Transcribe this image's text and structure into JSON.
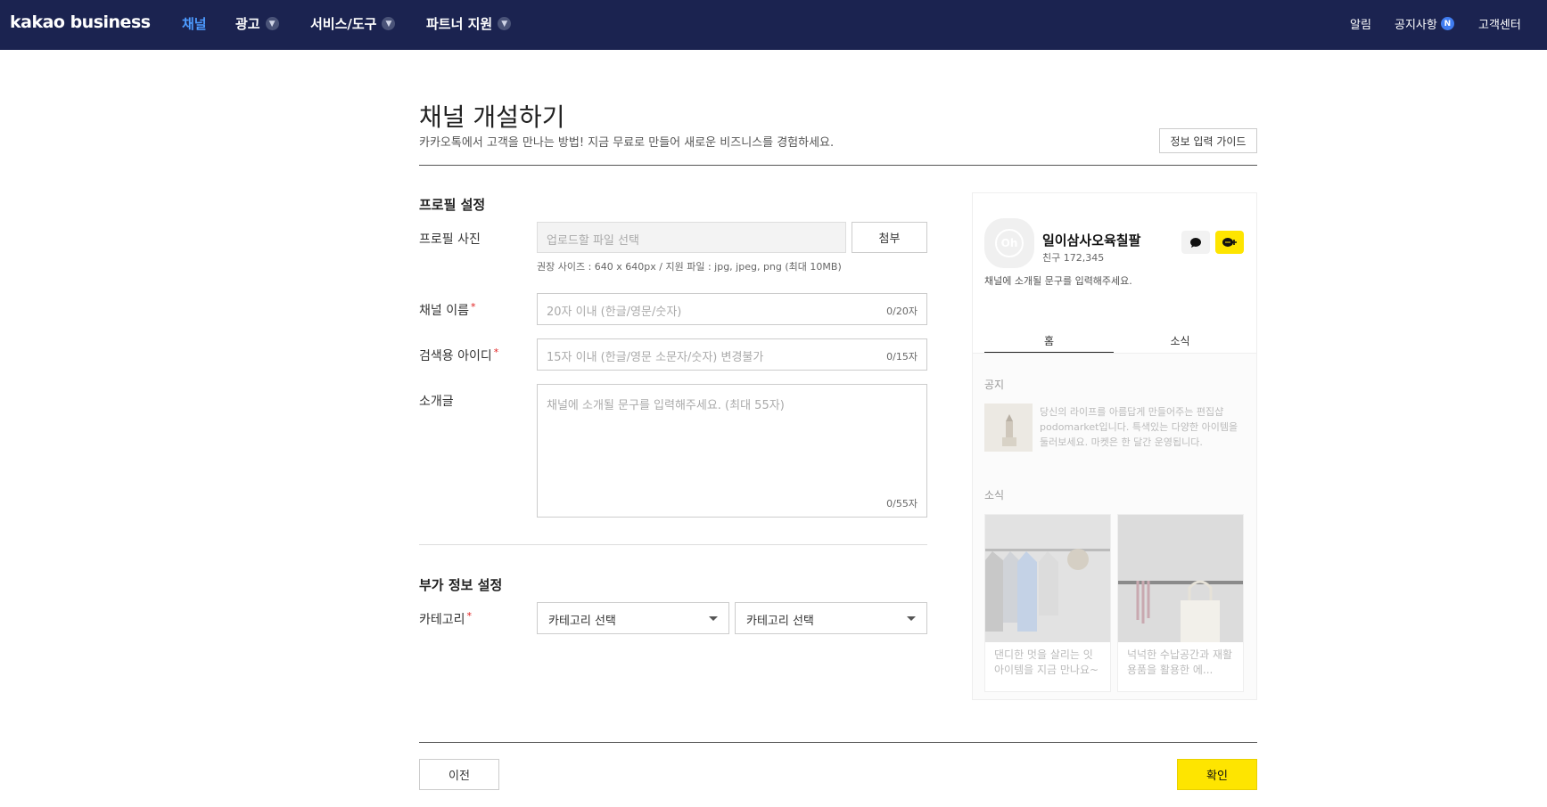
{
  "nav": {
    "logo": "kakao business",
    "items": [
      {
        "label": "채널",
        "active": true,
        "dropdown": false
      },
      {
        "label": "광고",
        "active": false,
        "dropdown": true
      },
      {
        "label": "서비스/도구",
        "active": false,
        "dropdown": true
      },
      {
        "label": "파트너 지원",
        "active": false,
        "dropdown": true
      }
    ],
    "right": {
      "alarm": "알림",
      "notice": "공지사항",
      "notice_badge": "N",
      "support": "고객센터"
    }
  },
  "header": {
    "title": "채널 개설하기",
    "subtitle": "카카오톡에서 고객을 만나는 방법! 지금 무료로 만들어 새로운 비즈니스를 경험하세요.",
    "guide_button": "정보 입력 가이드"
  },
  "profile": {
    "section_title": "프로필 설정",
    "photo_label": "프로필 사진",
    "photo_placeholder": "업로드할 파일 선택",
    "attach_button": "첨부",
    "photo_hint": "권장 사이즈 : 640 x 640px / 지원 파일 : jpg, jpeg, png (최대 10MB)",
    "name_label": "채널 이름",
    "name_placeholder": "20자 이내 (한글/영문/숫자)",
    "name_counter": "0/20자",
    "id_label": "검색용 아이디",
    "id_placeholder": "15자 이내 (한글/영문 소문자/숫자) 변경불가",
    "id_counter": "0/15자",
    "intro_label": "소개글",
    "intro_placeholder": "채널에 소개될 문구를 입력해주세요. (최대 55자)",
    "intro_counter": "0/55자",
    "required_mark": "*"
  },
  "extra": {
    "section_title": "부가 정보 설정",
    "category_label": "카테고리",
    "category_select_1": "카테고리 선택",
    "category_select_2": "카테고리 선택"
  },
  "preview": {
    "avatar_text": "Oh",
    "channel_name": "일이삼사오육칠팔",
    "friends": "친구 172,345",
    "description": "채널에 소개될 문구를 입력해주세요.",
    "tabs": [
      "홈",
      "소식"
    ],
    "notice_title": "공지",
    "notice_text": "당신의 라이프를 아름답게 만들어주는 편집샵 podomarket입니다. 특색있는 다양한 아이템을 둘러보세요. 마켓은 한 달간 운영됩니다.",
    "news_title": "소식",
    "cards": [
      {
        "text": "댄디한 멋을 살리는 잇 아이템을 지금 만나요~"
      },
      {
        "text": "넉넉한 수납공간과 재활용품을 활용한 에..."
      }
    ]
  },
  "footer": {
    "prev_button": "이전",
    "confirm_button": "확인"
  },
  "colors": {
    "nav_bg": "#1b2350",
    "nav_active": "#4d9bff",
    "confirm_bg": "#fee500",
    "required": "#e02020"
  }
}
